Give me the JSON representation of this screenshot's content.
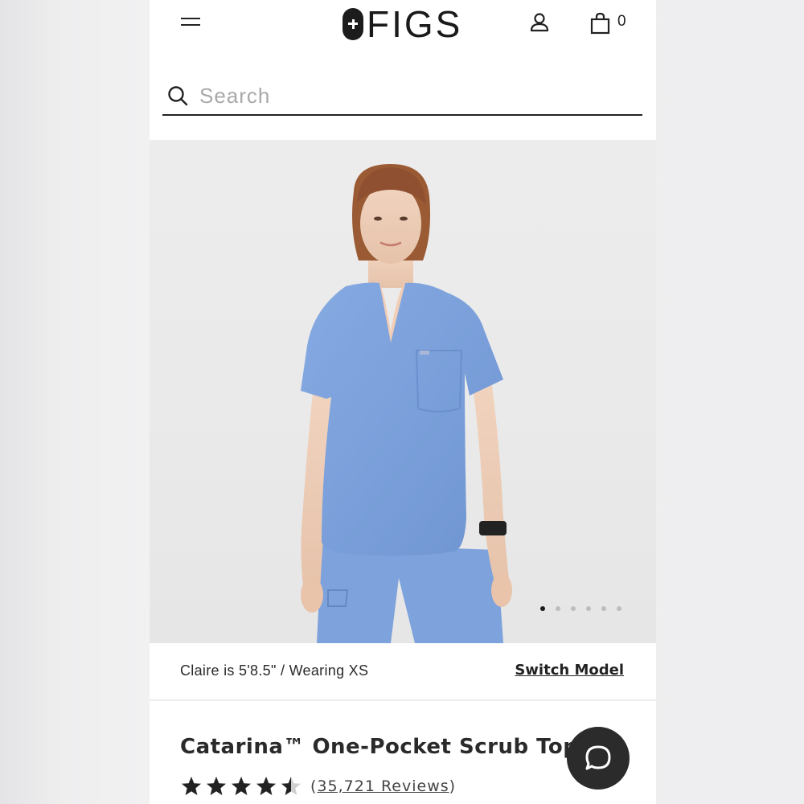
{
  "header": {
    "logo_text": "FIGS",
    "cart_count": "0"
  },
  "search": {
    "placeholder": "Search"
  },
  "product_image": {
    "carousel_total": 6,
    "carousel_active": 1
  },
  "model": {
    "info": "Claire is 5'8.5\" / Wearing XS",
    "switch_label": "Switch Model"
  },
  "product": {
    "title": "Catarina™ One-Pocket Scrub Top",
    "rating": 4.5,
    "reviews_open": "(",
    "reviews_count": "35,721 Reviews",
    "reviews_close": ")"
  },
  "colors": {
    "brand_dark": "#1c1c1c",
    "scrub_blue": "#7ea3dc"
  },
  "icons": [
    "menu-icon",
    "logo-cross-icon",
    "account-icon",
    "bag-icon",
    "search-icon",
    "star-icon",
    "chat-icon"
  ]
}
